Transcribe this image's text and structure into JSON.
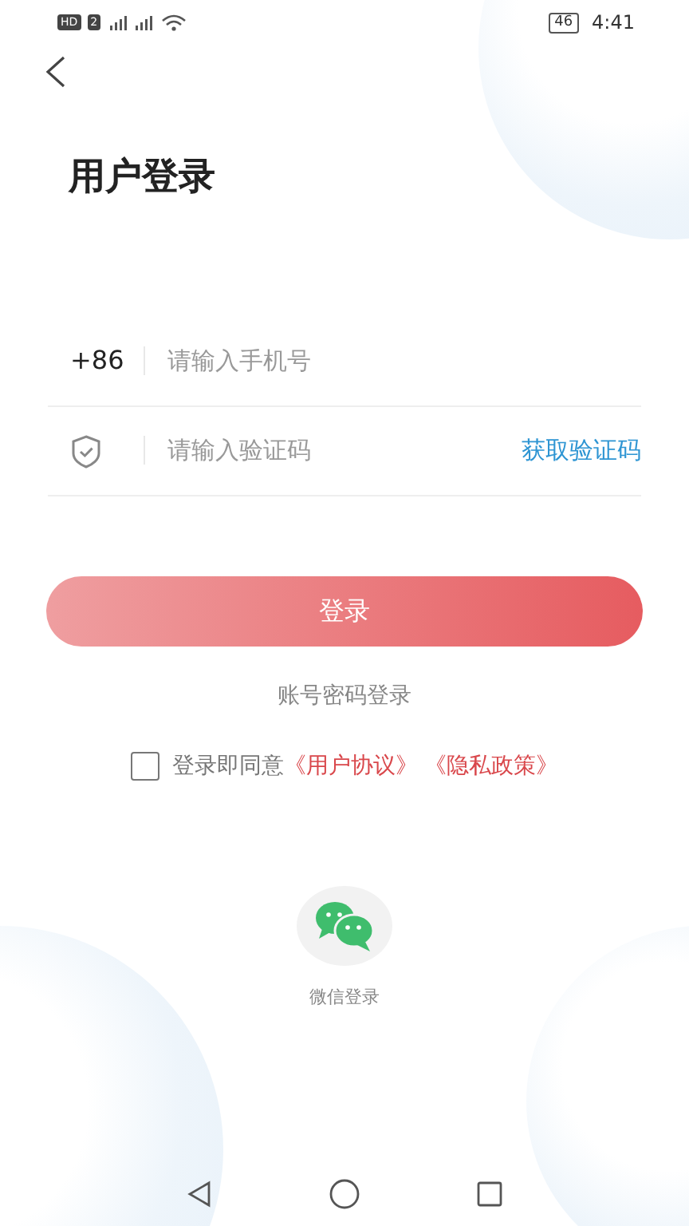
{
  "status_bar": {
    "badges": [
      "HD",
      "2"
    ],
    "battery": "46",
    "time": "4:41"
  },
  "title": "用户登录",
  "phone_field": {
    "prefix": "+86",
    "placeholder": "请输入手机号"
  },
  "code_field": {
    "placeholder": "请输入验证码",
    "action": "获取验证码"
  },
  "login_button": "登录",
  "password_login_link": "账号密码登录",
  "agreement": {
    "checked": false,
    "text": "登录即同意",
    "links": [
      "《用户协议》",
      "《隐私政策》"
    ]
  },
  "social_login": {
    "label": "微信登录"
  }
}
